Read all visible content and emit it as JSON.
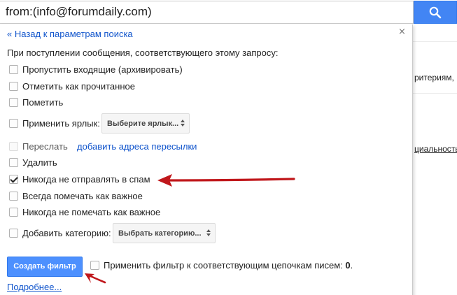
{
  "search": {
    "query": "from:(info@forumdaily.com)",
    "button_icon": "search-icon"
  },
  "background": {
    "text_fragment_1": "ритериям,",
    "text_fragment_2": "циальность"
  },
  "filter_panel": {
    "back_link": "« Назад к параметрам поиска",
    "close_label": "×",
    "intro": "При поступлении сообщения, соответствующего этому запросу:",
    "options": {
      "skip_inbox": {
        "label": "Пропустить входящие (архивировать)",
        "checked": false
      },
      "mark_read": {
        "label": "Отметить как прочитанное",
        "checked": false
      },
      "star": {
        "label": "Пометить",
        "checked": false
      },
      "apply_label": {
        "label": "Применить ярлык:",
        "checked": false,
        "select_value": "Выберите ярлык..."
      },
      "forward": {
        "label": "Переслать",
        "checked": false,
        "disabled": true,
        "link": "добавить адреса пересылки"
      },
      "delete": {
        "label": "Удалить",
        "checked": false
      },
      "never_spam": {
        "label": "Никогда не отправлять в спам",
        "checked": true
      },
      "always_important": {
        "label": "Всегда помечать как важное",
        "checked": false
      },
      "never_important": {
        "label": "Никогда не помечать как важное",
        "checked": false
      },
      "category": {
        "label": "Добавить категорию:",
        "checked": false,
        "select_value": "Выбрать категорию..."
      }
    },
    "create_button": "Создать фильтр",
    "apply_existing": {
      "label": "Применить фильтр к соответствующим цепочкам писем: ",
      "count": "0",
      "suffix": ".",
      "checked": false
    },
    "more_link": "Подробнее..."
  },
  "annotation_color": "#c0171b",
  "accent_color": "#4d90fe"
}
